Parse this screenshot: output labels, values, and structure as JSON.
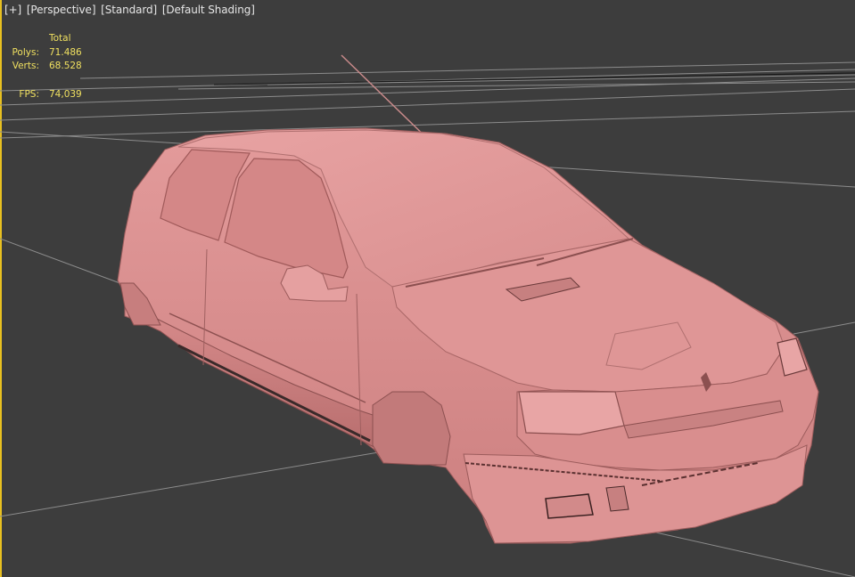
{
  "viewport": {
    "labels": {
      "plus": "[+]",
      "view": "[Perspective]",
      "mode": "[Standard]",
      "shading": "[Default Shading]"
    },
    "stats": {
      "header": "Total",
      "polys_label": "Polys:",
      "polys_value": "71.486",
      "verts_label": "Verts:",
      "verts_value": "68.528",
      "fps_label": "FPS:",
      "fps_value": "74,039"
    },
    "colors": {
      "background": "#3d3d3d",
      "grid": "#8a8a8a",
      "model": "#d98c8c",
      "stats_text": "#f0e060",
      "active_border": "#e8c020"
    }
  }
}
